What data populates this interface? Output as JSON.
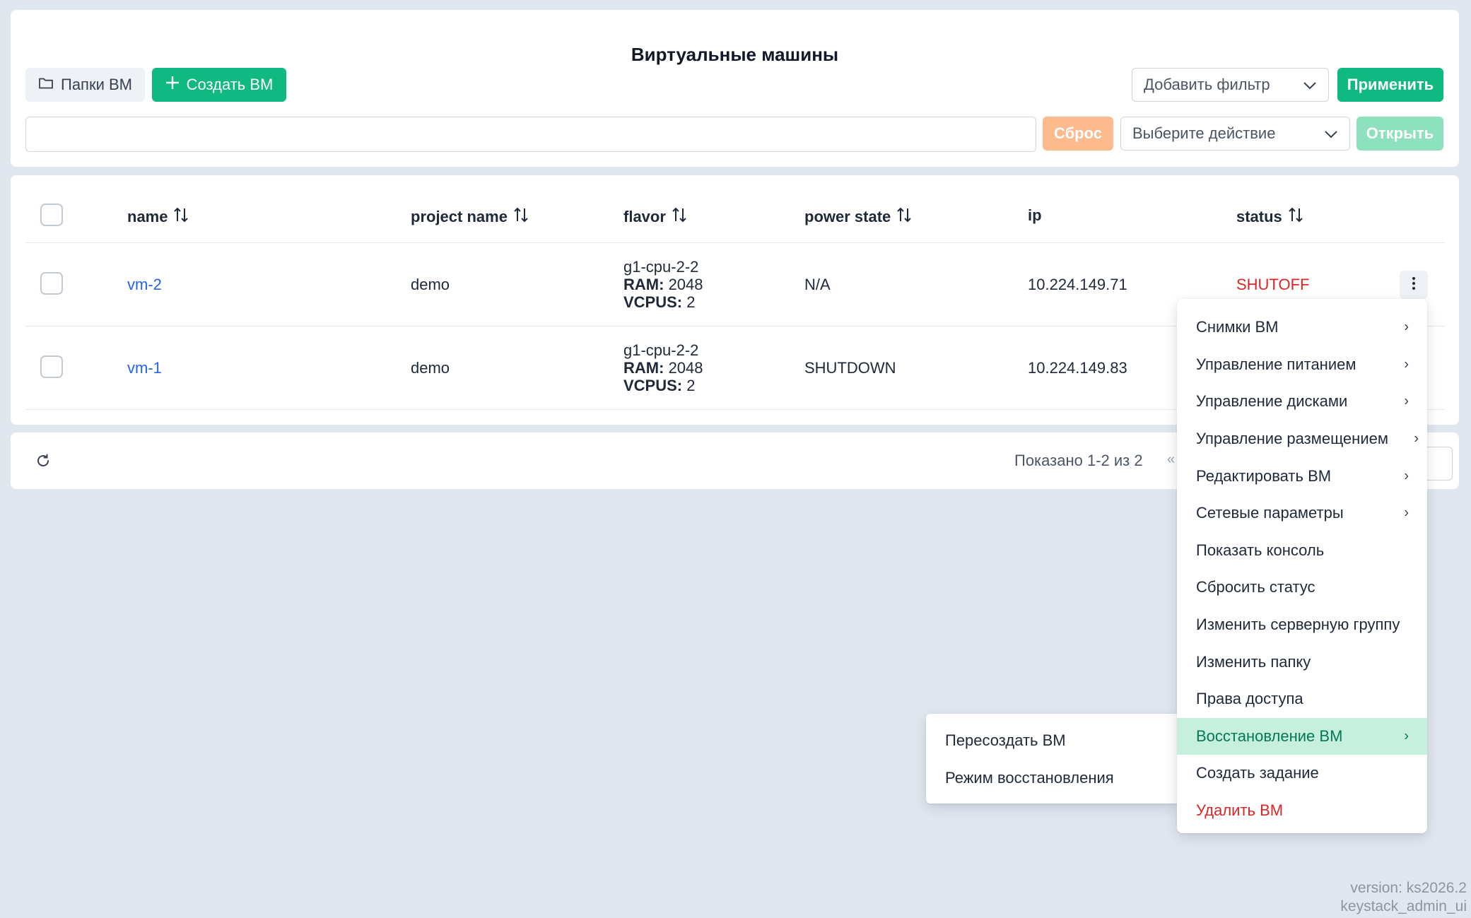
{
  "page": {
    "title": "Виртуальные машины"
  },
  "toolbar": {
    "folders_label": "Папки ВМ",
    "create_label": "Создать ВМ",
    "filter_placeholder": "Добавить фильтр",
    "apply_label": "Применить",
    "search_value": "",
    "reset_label": "Сброс",
    "action_placeholder": "Выберите действие",
    "open_label": "Открыть"
  },
  "table": {
    "columns": {
      "name": "name",
      "project": "project name",
      "flavor": "flavor",
      "power": "power state",
      "ip": "ip",
      "status": "status"
    },
    "flavor_ram_label": "RAM:",
    "flavor_vcpus_label": "VCPUS:",
    "rows": [
      {
        "name": "vm-2",
        "project": "demo",
        "flavor": "g1-cpu-2-2",
        "ram": "2048",
        "vcpus": "2",
        "power": "N/A",
        "ip": "10.224.149.71",
        "status": "SHUTOFF"
      },
      {
        "name": "vm-1",
        "project": "demo",
        "flavor": "g1-cpu-2-2",
        "ram": "2048",
        "vcpus": "2",
        "power": "SHUTDOWN",
        "ip": "10.224.149.83",
        "status": ""
      }
    ]
  },
  "footer": {
    "shown": "Показано 1-2 из 2",
    "pager_fragment": "«"
  },
  "context_menu": {
    "items": [
      {
        "label": "Снимки ВМ",
        "submenu": true
      },
      {
        "label": "Управление питанием",
        "submenu": true
      },
      {
        "label": "Управление дисками",
        "submenu": true
      },
      {
        "label": "Управление размещением",
        "submenu": true
      },
      {
        "label": "Редактировать ВМ",
        "submenu": true
      },
      {
        "label": "Сетевые параметры",
        "submenu": true
      },
      {
        "label": "Показать консоль",
        "submenu": false
      },
      {
        "label": "Сбросить статус",
        "submenu": false
      },
      {
        "label": "Изменить серверную группу",
        "submenu": false
      },
      {
        "label": "Изменить папку",
        "submenu": false
      },
      {
        "label": "Права доступа",
        "submenu": false
      },
      {
        "label": "Восстановление ВМ",
        "submenu": true,
        "active": true
      },
      {
        "label": "Создать задание",
        "submenu": false
      },
      {
        "label": "Удалить ВМ",
        "submenu": false,
        "danger": true
      }
    ]
  },
  "submenu": {
    "items": [
      {
        "label": "Пересоздать ВМ"
      },
      {
        "label": "Режим восстановления"
      }
    ]
  },
  "version": {
    "line1": "version: ks2026.2",
    "line2": "keystack_admin_ui"
  },
  "colors": {
    "accent": "#10b981",
    "danger": "#dc2626",
    "link": "#2563eb",
    "active_bg": "#c6f0dd",
    "background": "#e1e7ef"
  },
  "icons": {
    "folder": "folder-icon",
    "plus": "plus-icon",
    "chevron": "chevron-down-icon",
    "sort": "sort-icon",
    "kebab": "kebab-icon",
    "refresh": "refresh-icon",
    "chevron_right": "chevron-right-icon"
  }
}
